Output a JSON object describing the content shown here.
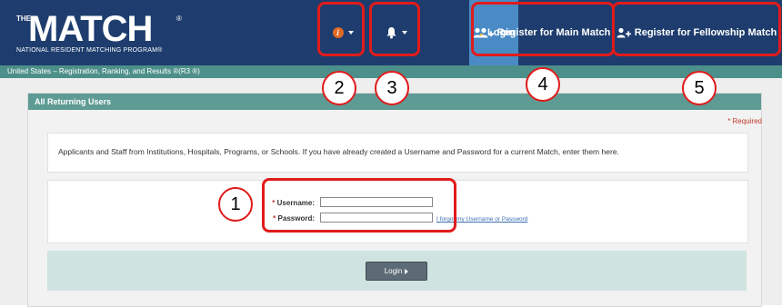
{
  "brand": {
    "the": "THE",
    "match": "MATCH",
    "reg": "®",
    "subtitle": "NATIONAL RESIDENT MATCHING PROGRAM®"
  },
  "nav": {
    "login_label": "Login",
    "register_main_label": "Register for Main Match",
    "register_fellowship_label": "Register for Fellowship Match"
  },
  "subbar": {
    "text": "United States – Registration, Ranking, and Results ®(R3 ®)"
  },
  "panel": {
    "title": "All Returning Users",
    "required": "* Required",
    "intro": "Applicants and Staff from Institutions, Hospitals, Programs, or Schools. If you have already created a Username and Password for a current Match, enter them here.",
    "username_label": "Username:",
    "password_label": "Password:",
    "required_star": "*",
    "forgot_link": "I forgot my Username or Password",
    "login_button": "Login"
  },
  "callouts": {
    "n1": "1",
    "n2": "2",
    "n3": "3",
    "n4": "4",
    "n5": "5"
  },
  "colors": {
    "navbar": "#1e3d6e",
    "active_tab": "#4a8bc6",
    "teal": "#4d8f8a",
    "highlight": "#e11b1b"
  },
  "icons": [
    "info-icon",
    "bell-icon",
    "user-login-icon",
    "add-user-icon",
    "add-user-icon",
    "caret-down-icon"
  ]
}
